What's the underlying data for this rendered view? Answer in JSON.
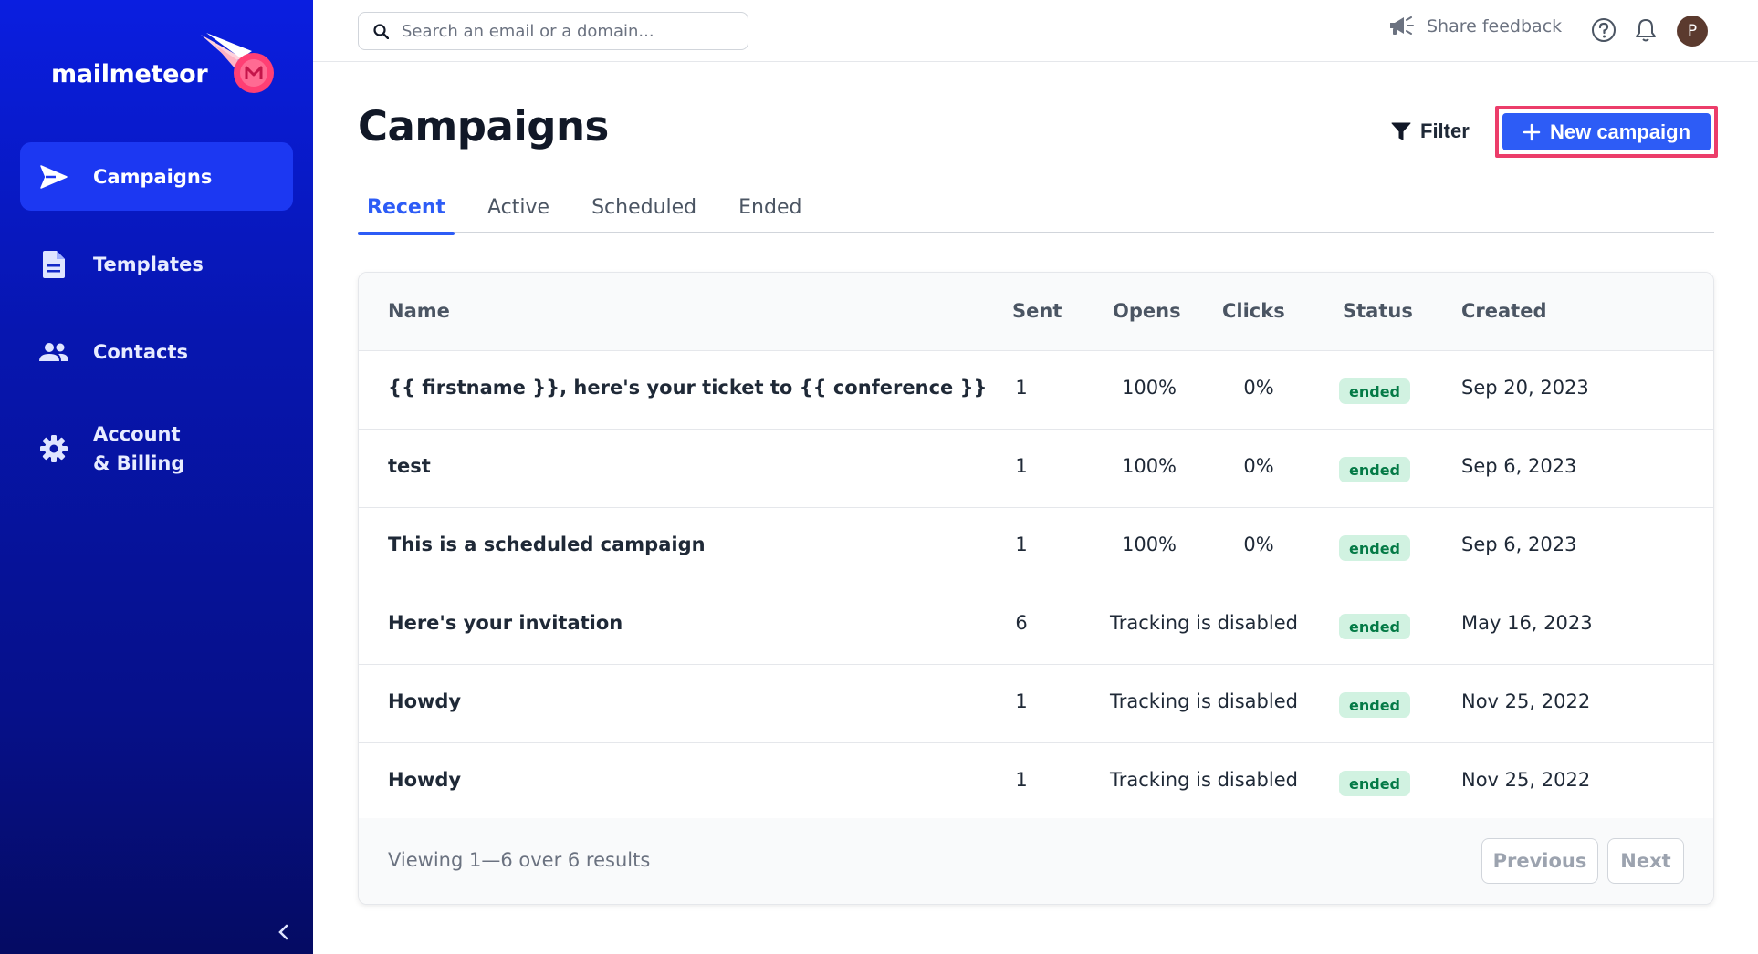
{
  "brand": {
    "name": "mailmeteor",
    "accent": "#2d5cf6",
    "sidebar_bg": "#0716b0"
  },
  "sidebar": {
    "items": [
      {
        "label": "Campaigns",
        "icon": "send-icon",
        "active": true
      },
      {
        "label": "Templates",
        "icon": "document-icon",
        "active": false
      },
      {
        "label": "Contacts",
        "icon": "users-icon",
        "active": false
      },
      {
        "label_line1": "Account",
        "label_line2": "& Billing",
        "icon": "gear-icon",
        "active": false
      }
    ],
    "collapse_icon": "chevron-left-icon"
  },
  "topbar": {
    "search_placeholder": "Search an email or a domain...",
    "feedback_label": "Share feedback",
    "avatar_initial": "P"
  },
  "main": {
    "title": "Campaigns",
    "filter_label": "Filter",
    "new_campaign_label": "New campaign",
    "tabs": [
      {
        "label": "Recent",
        "active": true
      },
      {
        "label": "Active",
        "active": false
      },
      {
        "label": "Scheduled",
        "active": false
      },
      {
        "label": "Ended",
        "active": false
      }
    ]
  },
  "table": {
    "headers": {
      "name": "Name",
      "sent": "Sent",
      "opens": "Opens",
      "clicks": "Clicks",
      "status": "Status",
      "created": "Created"
    },
    "rows": [
      {
        "name": "{{ firstname }}, here's your ticket to {{ conference }}",
        "sent": "1",
        "opens": "100%",
        "clicks": "0%",
        "tracking": "",
        "status": "ended",
        "created": "Sep 20, 2023"
      },
      {
        "name": "test",
        "sent": "1",
        "opens": "100%",
        "clicks": "0%",
        "tracking": "",
        "status": "ended",
        "created": "Sep 6, 2023"
      },
      {
        "name": "This is a scheduled campaign",
        "sent": "1",
        "opens": "100%",
        "clicks": "0%",
        "tracking": "",
        "status": "ended",
        "created": "Sep 6, 2023"
      },
      {
        "name": "Here's your invitation",
        "sent": "6",
        "opens": "",
        "clicks": "",
        "tracking": "Tracking is disabled",
        "status": "ended",
        "created": "May 16, 2023"
      },
      {
        "name": "Howdy",
        "sent": "1",
        "opens": "",
        "clicks": "",
        "tracking": "Tracking is disabled",
        "status": "ended",
        "created": "Nov 25, 2022"
      },
      {
        "name": "Howdy",
        "sent": "1",
        "opens": "",
        "clicks": "",
        "tracking": "Tracking is disabled",
        "status": "ended",
        "created": "Nov 25, 2022"
      }
    ],
    "footer": {
      "summary": "Viewing 1—6 over 6 results",
      "previous": "Previous",
      "next": "Next"
    }
  }
}
